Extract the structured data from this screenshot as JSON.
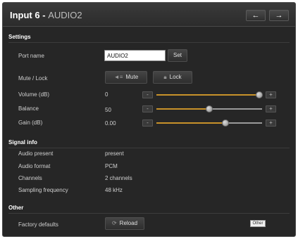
{
  "window": {
    "title": "Input 6",
    "separator": "-",
    "subtitle": "AUDIO2",
    "prev_label": "←",
    "next_label": "→"
  },
  "settings": {
    "title": "Settings",
    "port_name_label": "Port name",
    "port_name_value": "AUDIO2",
    "set_label": "Set",
    "mute_lock_label": "Mute / Lock",
    "mute_label": "Mute",
    "lock_label": "Lock",
    "mute_icon": "speaker-icon",
    "lock_icon": "padlock-icon",
    "volume_label": "Volume (dB)",
    "volume_value": "0",
    "volume_level": 0.97,
    "balance_label": "Balance",
    "balance_value": "50",
    "balance_level": 0.5,
    "gain_label": "Gain (dB)",
    "gain_value": "0.00",
    "gain_level": 0.65,
    "minus": "-",
    "plus": "+",
    "accent_color": "#c8922a"
  },
  "signal": {
    "title": "Signal info",
    "audio_present_label": "Audio present",
    "audio_present_value": "present",
    "audio_format_label": "Audio format",
    "audio_format_value": "PCM",
    "channels_label": "Channels",
    "channels_value": "2 channels",
    "sampling_label": "Sampling frequency",
    "sampling_value": "48 kHz"
  },
  "other": {
    "title": "Other",
    "factory_label": "Factory defaults",
    "reload_label": "Reload",
    "reload_icon": "reload-icon",
    "badge": "Other"
  }
}
